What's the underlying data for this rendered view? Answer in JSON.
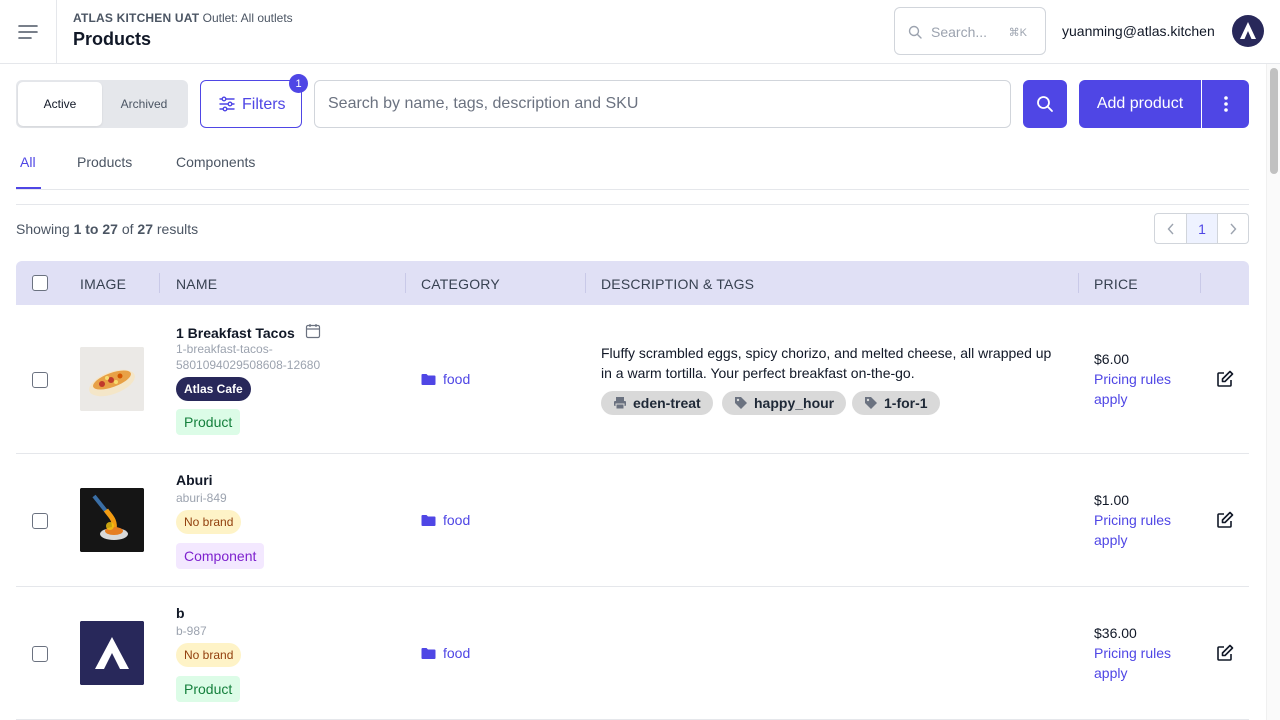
{
  "header": {
    "org_name": "ATLAS KITCHEN UAT",
    "outlet": "Outlet: All outlets",
    "page_title": "Products",
    "search_placeholder": "Search...",
    "search_shortcut": "⌘K",
    "user_email": "yuanming@atlas.kitchen"
  },
  "toolbar": {
    "segment_active": "Active",
    "segment_archived": "Archived",
    "filters_label": "Filters",
    "filters_count": "1",
    "search_placeholder": "Search by name, tags, description and SKU",
    "add_label": "Add product"
  },
  "tabs": [
    {
      "label": "All",
      "active": true
    },
    {
      "label": "Products",
      "active": false
    },
    {
      "label": "Components",
      "active": false
    }
  ],
  "results": {
    "prefix": "Showing",
    "from_to": "1 to 27",
    "of": "of",
    "total": "27",
    "suffix": "results"
  },
  "pagination": {
    "current": "1"
  },
  "table": {
    "columns": [
      "IMAGE",
      "NAME",
      "CATEGORY",
      "DESCRIPTION & TAGS",
      "PRICE"
    ],
    "rows": [
      {
        "name": "1 Breakfast Tacos",
        "sku": "1-breakfast-tacos-5801094029508608-12680",
        "brand": "Atlas Cafe",
        "type": "Product",
        "category": "food",
        "description": "Fluffy scrambled eggs, spicy chorizo, and melted cheese, all wrapped up in a warm tortilla. Your perfect breakfast on-the-go.",
        "tags": [
          {
            "label": "eden-treat",
            "icon": "printer-icon"
          },
          {
            "label": "happy_hour",
            "icon": "tag-icon"
          },
          {
            "label": "1-for-1",
            "icon": "tag-icon"
          }
        ],
        "price": "$6.00",
        "pricing_rules": "Pricing rules apply"
      },
      {
        "name": "Aburi",
        "sku": "aburi-849",
        "brand": "No brand",
        "type": "Component",
        "category": "food",
        "description": "",
        "tags": [],
        "price": "$1.00",
        "pricing_rules": "Pricing rules apply"
      },
      {
        "name": "b",
        "sku": "b-987",
        "brand": "No brand",
        "type": "Product",
        "category": "food",
        "description": "",
        "tags": [],
        "price": "$36.00",
        "pricing_rules": "Pricing rules apply"
      }
    ]
  },
  "colors": {
    "accent": "#4f46e5",
    "brand_dark": "#28285a",
    "table_header": "#e0e0f5"
  }
}
